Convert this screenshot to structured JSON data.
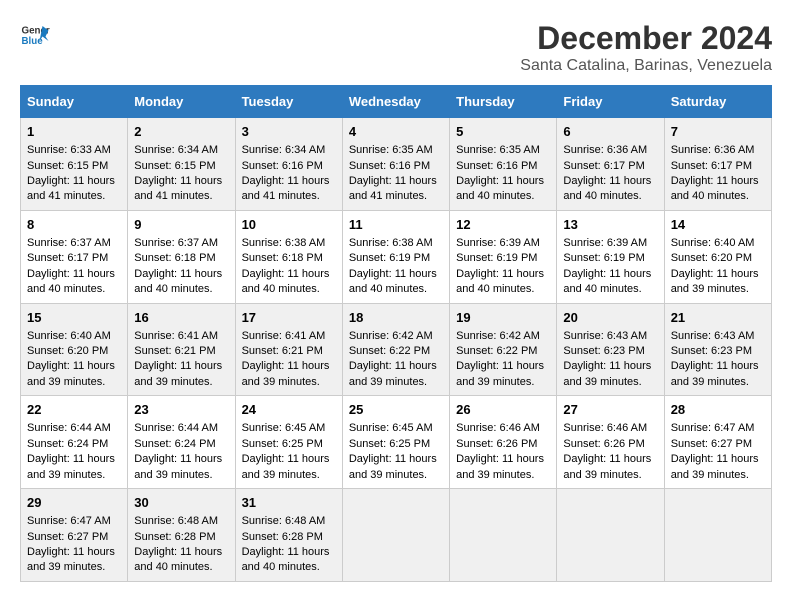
{
  "logo": {
    "line1": "General",
    "line2": "Blue"
  },
  "title": "December 2024",
  "subtitle": "Santa Catalina, Barinas, Venezuela",
  "days_of_week": [
    "Sunday",
    "Monday",
    "Tuesday",
    "Wednesday",
    "Thursday",
    "Friday",
    "Saturday"
  ],
  "weeks": [
    [
      {
        "day": "1",
        "sunrise": "6:33 AM",
        "sunset": "6:15 PM",
        "daylight": "11 hours and 41 minutes."
      },
      {
        "day": "2",
        "sunrise": "6:34 AM",
        "sunset": "6:15 PM",
        "daylight": "11 hours and 41 minutes."
      },
      {
        "day": "3",
        "sunrise": "6:34 AM",
        "sunset": "6:16 PM",
        "daylight": "11 hours and 41 minutes."
      },
      {
        "day": "4",
        "sunrise": "6:35 AM",
        "sunset": "6:16 PM",
        "daylight": "11 hours and 41 minutes."
      },
      {
        "day": "5",
        "sunrise": "6:35 AM",
        "sunset": "6:16 PM",
        "daylight": "11 hours and 40 minutes."
      },
      {
        "day": "6",
        "sunrise": "6:36 AM",
        "sunset": "6:17 PM",
        "daylight": "11 hours and 40 minutes."
      },
      {
        "day": "7",
        "sunrise": "6:36 AM",
        "sunset": "6:17 PM",
        "daylight": "11 hours and 40 minutes."
      }
    ],
    [
      {
        "day": "8",
        "sunrise": "6:37 AM",
        "sunset": "6:17 PM",
        "daylight": "11 hours and 40 minutes."
      },
      {
        "day": "9",
        "sunrise": "6:37 AM",
        "sunset": "6:18 PM",
        "daylight": "11 hours and 40 minutes."
      },
      {
        "day": "10",
        "sunrise": "6:38 AM",
        "sunset": "6:18 PM",
        "daylight": "11 hours and 40 minutes."
      },
      {
        "day": "11",
        "sunrise": "6:38 AM",
        "sunset": "6:19 PM",
        "daylight": "11 hours and 40 minutes."
      },
      {
        "day": "12",
        "sunrise": "6:39 AM",
        "sunset": "6:19 PM",
        "daylight": "11 hours and 40 minutes."
      },
      {
        "day": "13",
        "sunrise": "6:39 AM",
        "sunset": "6:19 PM",
        "daylight": "11 hours and 40 minutes."
      },
      {
        "day": "14",
        "sunrise": "6:40 AM",
        "sunset": "6:20 PM",
        "daylight": "11 hours and 39 minutes."
      }
    ],
    [
      {
        "day": "15",
        "sunrise": "6:40 AM",
        "sunset": "6:20 PM",
        "daylight": "11 hours and 39 minutes."
      },
      {
        "day": "16",
        "sunrise": "6:41 AM",
        "sunset": "6:21 PM",
        "daylight": "11 hours and 39 minutes."
      },
      {
        "day": "17",
        "sunrise": "6:41 AM",
        "sunset": "6:21 PM",
        "daylight": "11 hours and 39 minutes."
      },
      {
        "day": "18",
        "sunrise": "6:42 AM",
        "sunset": "6:22 PM",
        "daylight": "11 hours and 39 minutes."
      },
      {
        "day": "19",
        "sunrise": "6:42 AM",
        "sunset": "6:22 PM",
        "daylight": "11 hours and 39 minutes."
      },
      {
        "day": "20",
        "sunrise": "6:43 AM",
        "sunset": "6:23 PM",
        "daylight": "11 hours and 39 minutes."
      },
      {
        "day": "21",
        "sunrise": "6:43 AM",
        "sunset": "6:23 PM",
        "daylight": "11 hours and 39 minutes."
      }
    ],
    [
      {
        "day": "22",
        "sunrise": "6:44 AM",
        "sunset": "6:24 PM",
        "daylight": "11 hours and 39 minutes."
      },
      {
        "day": "23",
        "sunrise": "6:44 AM",
        "sunset": "6:24 PM",
        "daylight": "11 hours and 39 minutes."
      },
      {
        "day": "24",
        "sunrise": "6:45 AM",
        "sunset": "6:25 PM",
        "daylight": "11 hours and 39 minutes."
      },
      {
        "day": "25",
        "sunrise": "6:45 AM",
        "sunset": "6:25 PM",
        "daylight": "11 hours and 39 minutes."
      },
      {
        "day": "26",
        "sunrise": "6:46 AM",
        "sunset": "6:26 PM",
        "daylight": "11 hours and 39 minutes."
      },
      {
        "day": "27",
        "sunrise": "6:46 AM",
        "sunset": "6:26 PM",
        "daylight": "11 hours and 39 minutes."
      },
      {
        "day": "28",
        "sunrise": "6:47 AM",
        "sunset": "6:27 PM",
        "daylight": "11 hours and 39 minutes."
      }
    ],
    [
      {
        "day": "29",
        "sunrise": "6:47 AM",
        "sunset": "6:27 PM",
        "daylight": "11 hours and 39 minutes."
      },
      {
        "day": "30",
        "sunrise": "6:48 AM",
        "sunset": "6:28 PM",
        "daylight": "11 hours and 40 minutes."
      },
      {
        "day": "31",
        "sunrise": "6:48 AM",
        "sunset": "6:28 PM",
        "daylight": "11 hours and 40 minutes."
      },
      null,
      null,
      null,
      null
    ]
  ]
}
